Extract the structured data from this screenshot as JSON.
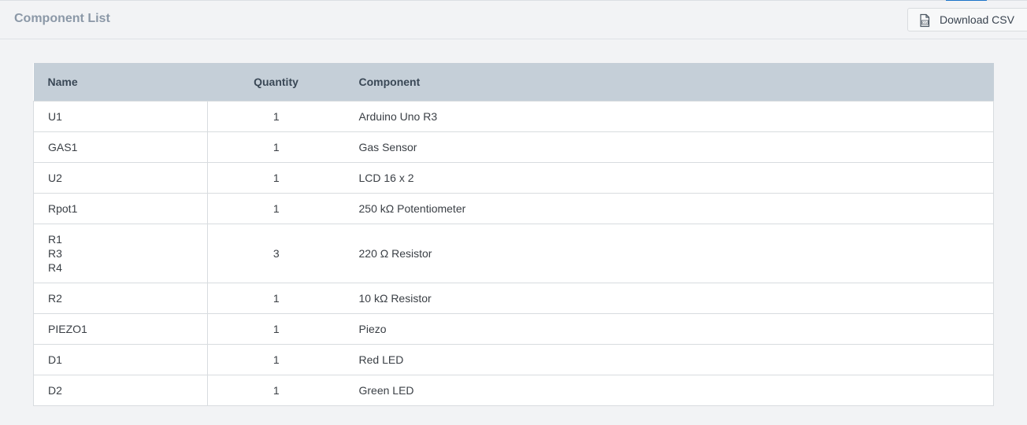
{
  "header": {
    "title": "Component List",
    "download_label": "Download CSV",
    "accent_color": "#1a73c8"
  },
  "table": {
    "columns": [
      "Name",
      "Quantity",
      "Component"
    ],
    "rows": [
      {
        "names": [
          "U1"
        ],
        "quantity": "1",
        "component": "Arduino Uno R3"
      },
      {
        "names": [
          "GAS1"
        ],
        "quantity": "1",
        "component": "Gas Sensor"
      },
      {
        "names": [
          "U2"
        ],
        "quantity": "1",
        "component": "LCD 16 x 2"
      },
      {
        "names": [
          "Rpot1"
        ],
        "quantity": "1",
        "component": "250 kΩ Potentiometer"
      },
      {
        "names": [
          "R1",
          "R3",
          "R4"
        ],
        "quantity": "3",
        "component": "220 Ω Resistor"
      },
      {
        "names": [
          "R2"
        ],
        "quantity": "1",
        "component": "10 kΩ Resistor"
      },
      {
        "names": [
          "PIEZO1"
        ],
        "quantity": "1",
        "component": "Piezo"
      },
      {
        "names": [
          "D1"
        ],
        "quantity": "1",
        "component": "Red LED"
      },
      {
        "names": [
          "D2"
        ],
        "quantity": "1",
        "component": "Green LED"
      }
    ]
  },
  "icons": {
    "download": "csv-file-icon"
  }
}
